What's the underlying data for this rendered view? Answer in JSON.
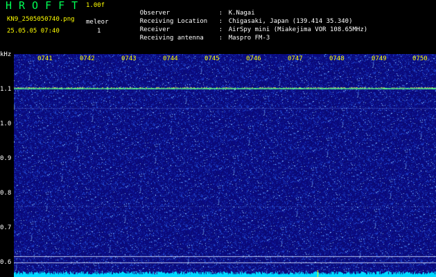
{
  "header": {
    "app_name": "HROFFT",
    "version": "1.00f",
    "filename": "KN9_2505050740.png",
    "mode_label": "meleor",
    "datetime": "25.05.05 07:40",
    "count": "1"
  },
  "meta": [
    {
      "label": "Observer",
      "value": "K.Nagai"
    },
    {
      "label": "Receiving Location",
      "value": "Chigasaki, Japan (139.414 35.340)"
    },
    {
      "label": "Receiver",
      "value": "AirSpy mini (Miakejima VOR 108.65MHz)"
    },
    {
      "label": "Receiving antenna",
      "value": "Maspro FM-3"
    }
  ],
  "axis": {
    "unit": "kHz",
    "y_labels": [
      "1.1",
      "1.0",
      "0.9",
      "0.8",
      "0.7",
      "0.6"
    ],
    "time_labels": [
      "0741",
      "0742",
      "0743",
      "0744",
      "0745",
      "0746",
      "0747",
      "0748",
      "0749",
      "0750"
    ]
  },
  "colors": {
    "background": "#0a0a78",
    "signal_line": "#55ff88",
    "noise_floor": "#00d8ff",
    "marker": "#ffff00"
  }
}
